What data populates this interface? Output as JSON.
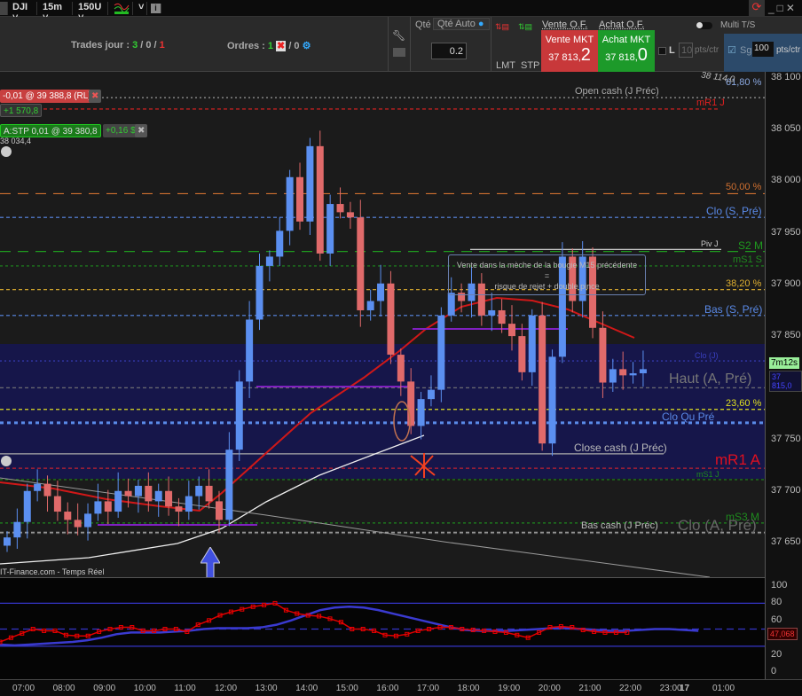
{
  "toolbar": {
    "symbol": "DJI",
    "timeframe": "15m",
    "units": "150U",
    "info_icon": "info-icon"
  },
  "panel": {
    "trades_label": "Trades jour : ",
    "trades_win": "3",
    "trades_sep1": " / 0 / ",
    "trades_loss": "1",
    "orders_label": "Ordres : ",
    "orders_count": "1",
    "orders_rest": " / 0",
    "qty_label": "Qté",
    "qty_auto": "Qté Auto",
    "qty_value": "0.2",
    "lmt": "LMT",
    "stp": "STP",
    "vente_of": "Vente O.F.",
    "achat_of": "Achat O.F.",
    "sell_label": "Vente MKT",
    "sell_price_main": "37 813,",
    "sell_price_dec": "2",
    "buy_label": "Achat MKT",
    "buy_price_main": "37 818,",
    "buy_price_dec": "0",
    "multi_ts": "Multi T/S",
    "l_label": "L",
    "l_value": "10",
    "pts_ctr": "pts/ctr",
    "sg_label": "Sg",
    "sg_value": "100",
    "pts_ctr2": "pts/ctr"
  },
  "orders": {
    "sell_order": "-0,01 @ 39 388,8 (RL)",
    "sell_pnl": "+1 570,8",
    "stop_order": "A:STP 0,01 @ 39 380,8",
    "stop_pnl": "+0,16 $",
    "partial_price": "38 034,4"
  },
  "levels": [
    {
      "label": "Open cash (J Préc)",
      "price": 38081,
      "color": "#999",
      "style": "2,3"
    },
    {
      "label": "mR1 J",
      "price": 38070,
      "color": "#e02020",
      "style": "4,3"
    },
    {
      "label": "61,80 %",
      "price": 38090,
      "color": "#8aa8e0",
      "style": "none"
    },
    {
      "label": "50,00 %",
      "price": 37988,
      "color": "#d07030",
      "style": "12,8"
    },
    {
      "label": "Clo (S, Pré)",
      "price": 37965,
      "color": "#5a8ae8",
      "style": "4,3"
    },
    {
      "label": "S2 M",
      "price": 37932,
      "color": "#1e9a1e",
      "style": "12,8"
    },
    {
      "label": "Piv J",
      "price": 37934,
      "color": "#ddd",
      "style": "none"
    },
    {
      "label": "mS1 S",
      "price": 37918,
      "color": "#1e8a1e",
      "style": "3,3"
    },
    {
      "label": "38,20 %",
      "price": 37895,
      "color": "#e0b030",
      "style": "4,3"
    },
    {
      "label": "Bas (S, Pré)",
      "price": 37870,
      "color": "#5a8ae8",
      "style": "4,3"
    },
    {
      "label": "Clo (J)",
      "price": 37826,
      "color": "#3a40c0",
      "style": "2,3"
    },
    {
      "label": "Haut (A, Pré)",
      "price": 37800,
      "color": "#777",
      "style": "4,3"
    },
    {
      "label": "23,60 %",
      "price": 37779,
      "color": "#e0e020",
      "style": "4,3"
    },
    {
      "label": "Clo Qu Pré",
      "price": 37766,
      "color": "#5a8ae8",
      "style": "4,4"
    },
    {
      "label": "Close cash (J Préc)",
      "price": 37736,
      "color": "#aaa",
      "style": "none"
    },
    {
      "label": "mR1 A",
      "price": 37722,
      "color": "#c02030",
      "style": "4,3"
    },
    {
      "label": "mS1 J",
      "price": 37711,
      "color": "#1e8a1e",
      "style": "3,3"
    },
    {
      "label": "mS3 M",
      "price": 37669,
      "color": "#1e8a1e",
      "style": "3,3"
    },
    {
      "label": "Bas cash (J Préc)",
      "price": 37660,
      "color": "#aaa",
      "style": "4,3"
    },
    {
      "label": "Clo (A, Pré)",
      "price": 37659,
      "color": "#666",
      "style": "4,3"
    }
  ],
  "annotation": {
    "line1": "Vente dans la mèche de la bougie M15 précédente",
    "line2": "=",
    "line3": "risque de rejet + double pince"
  },
  "price_axis": {
    "ticks": [
      "38 100",
      "38 050",
      "38 000",
      "37 950",
      "37 900",
      "37 850",
      "37 800",
      "37 750",
      "37 700",
      "37 650"
    ],
    "timer": "7m12s",
    "current": "37 815,0",
    "peak_label": "38 114,0"
  },
  "osc_axis": {
    "ticks": [
      "100",
      "80",
      "60",
      "40",
      "20",
      "0"
    ],
    "current": "47,068"
  },
  "time_axis": [
    "07:00",
    "08:00",
    "09:00",
    "10:00",
    "11:00",
    "12:00",
    "13:00",
    "14:00",
    "15:00",
    "16:00",
    "17:00",
    "18:00",
    "19:00",
    "20:00",
    "21:00",
    "22:00",
    "23:00",
    "17",
    "01:00"
  ],
  "source": "IT-Finance.com - Temps Réel",
  "chart_data": {
    "type": "candlestick",
    "start": "06:30",
    "interval_min": 15,
    "ylim": [
      37620,
      38120
    ],
    "closes": [
      37655,
      37670,
      37700,
      37707,
      37695,
      37680,
      37672,
      37665,
      37678,
      37690,
      37680,
      37700,
      37695,
      37705,
      37690,
      37700,
      37685,
      37680,
      37695,
      37705,
      37690,
      37672,
      37740,
      37806,
      37866,
      37918,
      37927,
      37952,
      38004,
      37961,
      38034,
      37930,
      37978,
      37970,
      37965,
      37875,
      37884,
      37901,
      37832,
      37806,
      37763,
      37789,
      37798,
      37870,
      37892,
      37884,
      37901,
      37870,
      37875,
      37862,
      37850,
      37815,
      37870,
      37746,
      37830,
      37927,
      37884,
      37927,
      37858,
      37805,
      37818,
      37812,
      37814,
      37818
    ],
    "oscillator": {
      "ylim": [
        0,
        100
      ],
      "bands": [
        80,
        50,
        30
      ],
      "fast": [
        35,
        40,
        45,
        50,
        48,
        48,
        43,
        42,
        42,
        47,
        50,
        52,
        52,
        48,
        48,
        50,
        50,
        47,
        55,
        60,
        66,
        70,
        73,
        76,
        78,
        80,
        72,
        68,
        66,
        65,
        62,
        58,
        50,
        50,
        48,
        43,
        42,
        44,
        48,
        50,
        52,
        52,
        50,
        49,
        48,
        47,
        46,
        43,
        40,
        46,
        52,
        53,
        52,
        49,
        47,
        46,
        46,
        46
      ],
      "slow": [
        32,
        31,
        32,
        33,
        34,
        35,
        37,
        40,
        44,
        46,
        46,
        46,
        47,
        48,
        50,
        51,
        51,
        51,
        52,
        55,
        60,
        66,
        72,
        75,
        76,
        75,
        72,
        68,
        64,
        60,
        56,
        52,
        49,
        48,
        48,
        48,
        49,
        50,
        51,
        51,
        50,
        49,
        48,
        48,
        49,
        50,
        50,
        49,
        48
      ]
    },
    "colors": {
      "up": "#5b8ff0",
      "down": "#e06a6a",
      "fast": "#e00000",
      "slow": "#3a3ad0"
    }
  }
}
